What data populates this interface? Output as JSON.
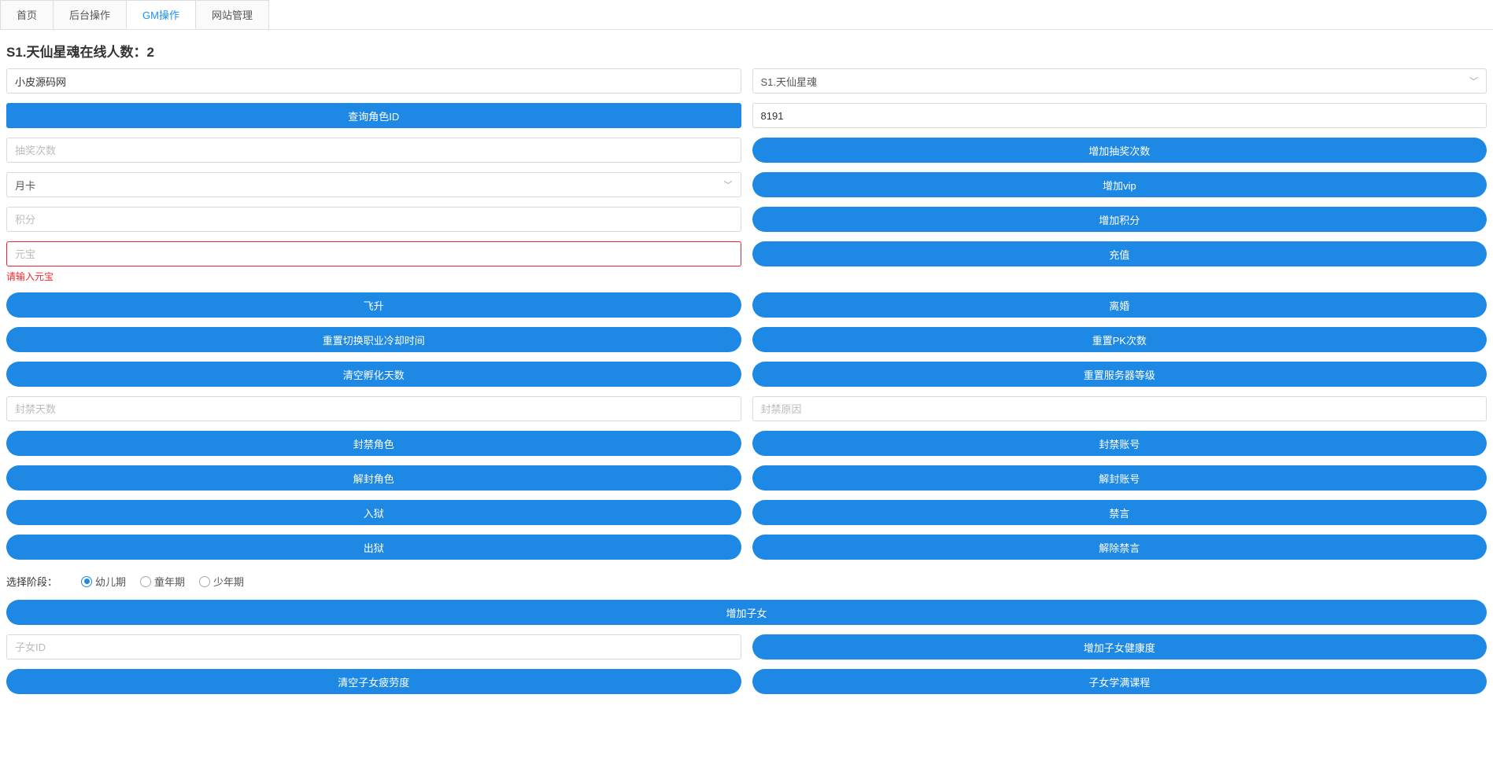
{
  "tabs": [
    "首页",
    "后台操作",
    "GM操作",
    "网站管理"
  ],
  "activeTab": 2,
  "pageTitle": "S1.天仙星魂在线人数：2",
  "row1": {
    "nameInput": "小皮源码网",
    "serverSelect": "S1.天仙星魂"
  },
  "row2": {
    "queryBtn": "查询角色ID",
    "idValue": "8191"
  },
  "lottery": {
    "placeholder": "抽奖次数",
    "btn": "增加抽奖次数"
  },
  "vip": {
    "select": "月卡",
    "btn": "增加vip"
  },
  "points": {
    "placeholder": "积分",
    "btn": "增加积分"
  },
  "yuanbao": {
    "placeholder": "元宝",
    "errorMsg": "请输入元宝",
    "btn": "充值"
  },
  "singleBtns": {
    "ascend": "飞升",
    "divorce": "离婚",
    "resetJobCd": "重置切换职业冷却时间",
    "resetPk": "重置PK次数",
    "clearHatch": "清空孵化天数",
    "resetServerLv": "重置服务器等级"
  },
  "ban": {
    "daysPh": "封禁天数",
    "reasonPh": "封禁原因"
  },
  "banBtns": {
    "banRole": "封禁角色",
    "banAccount": "封禁账号",
    "unbanRole": "解封角色",
    "unbanAccount": "解封账号",
    "jail": "入狱",
    "mute": "禁言",
    "unjail": "出狱",
    "unmute": "解除禁言"
  },
  "stage": {
    "label": "选择阶段：",
    "options": [
      "幼儿期",
      "童年期",
      "少年期"
    ],
    "checked": 0
  },
  "child": {
    "addBtn": "增加子女",
    "idPh": "子女ID",
    "healthBtn": "增加子女健康度",
    "clearFatigueBtn": "清空子女疲劳度",
    "courseBtn": "子女学满课程"
  }
}
